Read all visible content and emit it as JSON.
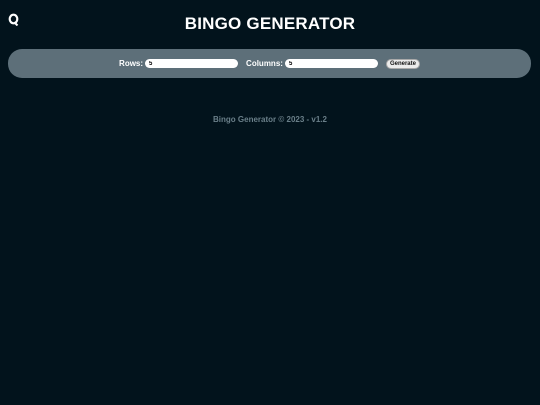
{
  "app": {
    "title": "BINGO GENERATOR",
    "logo_icon": "ring-logo-icon"
  },
  "controls": {
    "rows_label": "Rows:",
    "rows_value": "5",
    "columns_label": "Columns:",
    "columns_value": "5",
    "generate_label": "Generate"
  },
  "footer": {
    "text": "Bingo Generator © 2023 - v1.2"
  },
  "colors": {
    "background": "#02131c",
    "controls_bar": "#5d6f79",
    "footer_text": "#6a7f89"
  }
}
